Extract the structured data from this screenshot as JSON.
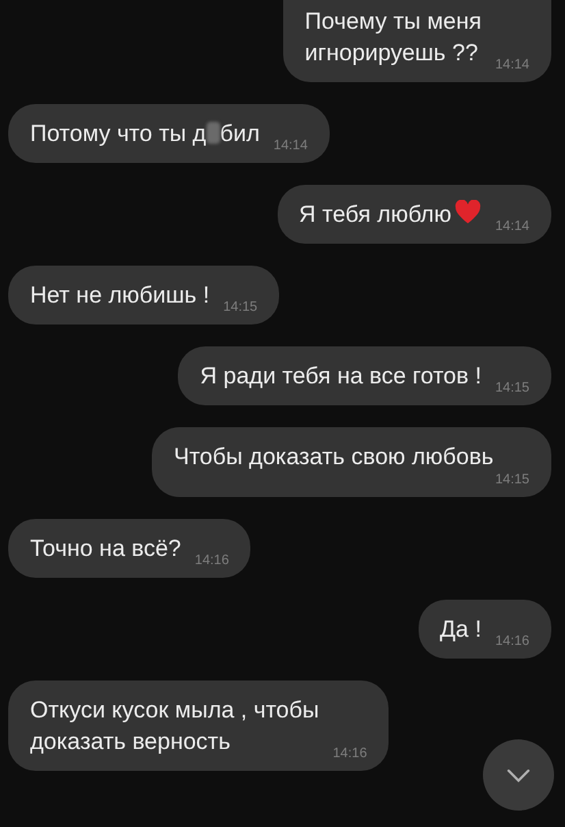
{
  "messages": [
    {
      "kind": "outgoing",
      "lines": [
        "Почему ты меня",
        "игнорируешь ??"
      ],
      "time": "14:14"
    },
    {
      "kind": "incoming",
      "lines": [
        "Потому что ты д"
      ],
      "lines_after": "бил",
      "censored": true,
      "time": "14:14"
    },
    {
      "kind": "outgoing",
      "lines": [
        "Я тебя люблю"
      ],
      "heart": true,
      "time": "14:14"
    },
    {
      "kind": "incoming",
      "lines": [
        "Нет не любишь !"
      ],
      "time": "14:15"
    },
    {
      "kind": "outgoing",
      "lines": [
        "Я ради тебя на все готов !"
      ],
      "time": "14:15"
    },
    {
      "kind": "outgoing",
      "lines": [
        "Чтобы доказать свою любовь"
      ],
      "time": "14:15"
    },
    {
      "kind": "incoming",
      "lines": [
        "Точно на всё?"
      ],
      "time": "14:16"
    },
    {
      "kind": "outgoing",
      "lines": [
        "Да !"
      ],
      "time": "14:16"
    },
    {
      "kind": "incoming",
      "lines": [
        "Откуси кусок мыла , чтобы",
        "доказать верность"
      ],
      "time": "14:16"
    }
  ],
  "scroll_down_button": true
}
